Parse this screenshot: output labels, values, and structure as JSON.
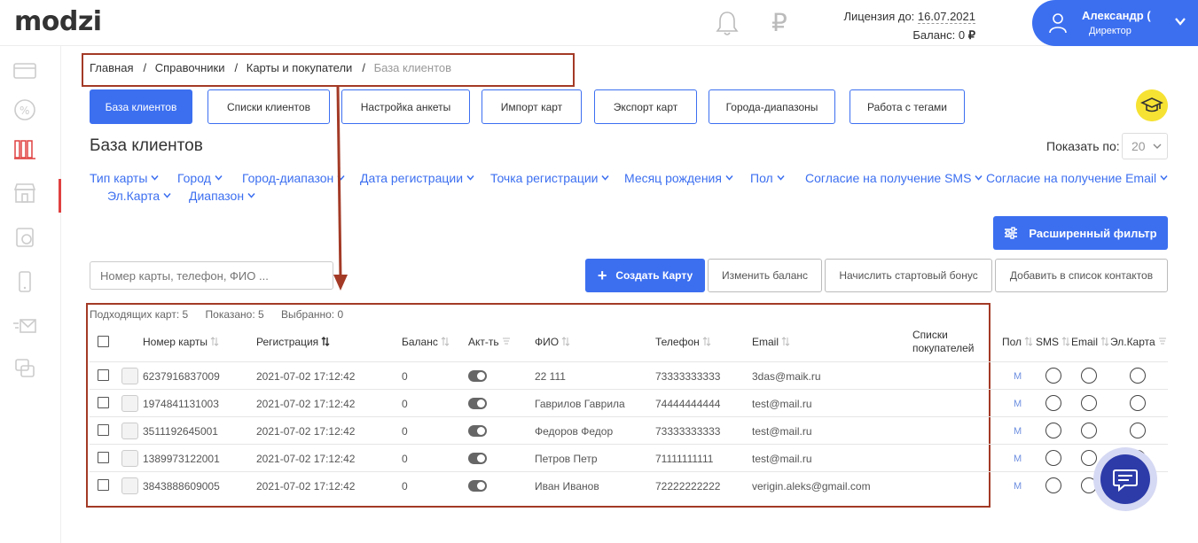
{
  "app": {
    "logo": "modzi"
  },
  "header": {
    "license_label": "Лицензия до:",
    "license_date": "16.07.2021",
    "balance_label": "Баланс:",
    "balance_value": "0",
    "currency": "₽",
    "user_name": "Александр (",
    "user_role": "Директор"
  },
  "breadcrumbs": [
    "Главная",
    "Справочники",
    "Карты и покупатели",
    "База клиентов"
  ],
  "breadcrumb_sep": "/",
  "tabs": [
    "База клиентов",
    "Списки клиентов",
    "Настройка анкеты",
    "Импорт карт",
    "Экспорт карт",
    "Города-диапазоны",
    "Работа с тегами"
  ],
  "page_title": "База клиентов",
  "show_by": {
    "label": "Показать по:",
    "value": "20"
  },
  "filters": [
    "Тип карты",
    "Город",
    "Город-диапазон",
    "Дата регистрации",
    "Точка регистрации",
    "Месяц рождения",
    "Пол",
    "Согласие на получение SMS",
    "Согласие на получение Email",
    "Эл.Карта",
    "Диапазон"
  ],
  "advanced_filter": "Расширенный фильтр",
  "search": {
    "placeholder": "Номер карты, телефон, ФИО ..."
  },
  "actions": {
    "create": "Создать Карту",
    "change_balance": "Изменить баланс",
    "start_bonus": "Начислить стартовый бонус",
    "add_contacts": "Добавить в список контактов"
  },
  "stats": {
    "matching": "Подходящих карт: 5",
    "shown": "Показано: 5",
    "selected": "Выбранно: 0"
  },
  "columns": {
    "card": "Номер карты",
    "reg": "Регистрация",
    "balance": "Баланс",
    "active": "Акт-ть",
    "fio": "ФИО",
    "phone": "Телефон",
    "email": "Email",
    "lists_1": "Списки",
    "lists_2": "покупателей",
    "sex": "Пол",
    "sms": "SMS",
    "email2": "Email",
    "ecard": "Эл.Карта"
  },
  "rows": [
    {
      "card": "6237916837009",
      "reg": "2021-07-02 17:12:42",
      "balance": "0",
      "fio": "22 111",
      "phone": "73333333333",
      "email": "3das@maik.ru",
      "sex": "М"
    },
    {
      "card": "1974841131003",
      "reg": "2021-07-02 17:12:42",
      "balance": "0",
      "fio": "Гаврилов Гаврила",
      "phone": "74444444444",
      "email": "test@mail.ru",
      "sex": "М"
    },
    {
      "card": "3511192645001",
      "reg": "2021-07-02 17:12:42",
      "balance": "0",
      "fio": "Федоров Федор",
      "phone": "73333333333",
      "email": "test@mail.ru",
      "sex": "М"
    },
    {
      "card": "1389973122001",
      "reg": "2021-07-02 17:12:42",
      "balance": "0",
      "fio": "Петров Петр",
      "phone": "71111111111",
      "email": "test@mail.ru",
      "sex": "М"
    },
    {
      "card": "3843888609005",
      "reg": "2021-07-02 17:12:42",
      "balance": "0",
      "fio": "Иван Иванов",
      "phone": "72222222222",
      "email": "verigin.aleks@gmail.com",
      "sex": "М"
    }
  ],
  "colors": {
    "accent": "#3c6ff0",
    "highlight": "#a33a26",
    "hat": "#f6e233",
    "chat": "#2c3ba8"
  }
}
